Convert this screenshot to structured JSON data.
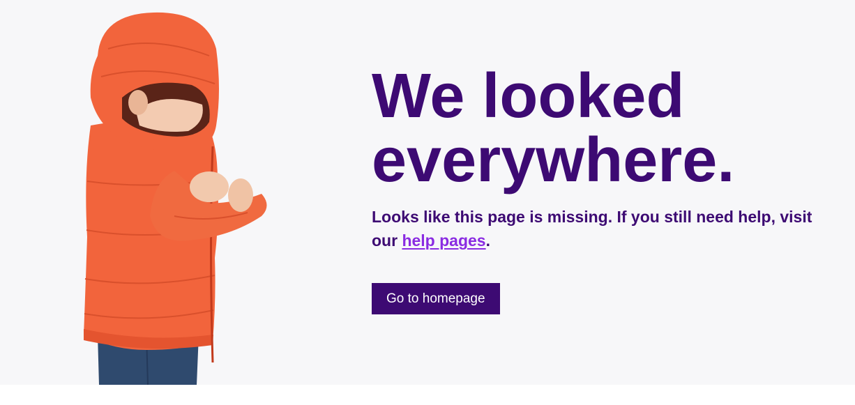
{
  "hero": {
    "image_icon": "child-in-orange-puffer-jacket-illustration"
  },
  "main": {
    "headline_line1": "We looked",
    "headline_line2": "everywhere.",
    "message_prefix": "Looks like this page is missing. If you still need help, visit our ",
    "help_link_label": "help pages",
    "message_suffix": ".",
    "homepage_button_label": "Go to homepage"
  },
  "colors": {
    "brand_purple": "#3d0a73",
    "link_purple": "#8a2be2",
    "background": "#f7f7f9",
    "jacket_orange": "#f2643c"
  }
}
